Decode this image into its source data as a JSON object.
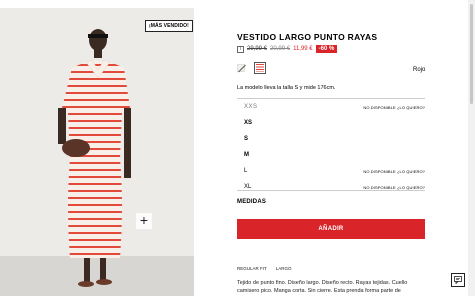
{
  "photo": {
    "badge": "¡MÁS VENDIDO!",
    "zoom_symbol": "+"
  },
  "product": {
    "title": "VESTIDO LARGO PUNTO RAYAS",
    "price_original": "29,99 €",
    "price_previous": "20,99 €",
    "price_sale": "11,99 €",
    "discount": "-60 %",
    "info_symbol": "i",
    "color_name": "Rojo",
    "model_info": "La modelo lleva la talla S y mide 176cm."
  },
  "sizes": [
    {
      "label": "XXS",
      "status": "NO DISPONIBLE ¿LO QUIERO?"
    },
    {
      "label": "XS",
      "status": ""
    },
    {
      "label": "S",
      "status": ""
    },
    {
      "label": "M",
      "status": ""
    },
    {
      "label": "L",
      "status": "NO DISPONIBLE ¿LO QUIERO?"
    },
    {
      "label": "XL",
      "status": "NO DISPONIBLE ¿LO QUIERO?"
    }
  ],
  "measures_label": "MEDIDAS",
  "add_button": "AÑADIR",
  "tags": [
    "REGULAR FIT",
    "LARGO"
  ],
  "description": "Tejido de punto fino. Diseño largo. Diseño recto. Rayas tejidas. Cuello camisero pico. Manga corta. Sin cierre. Esta prenda forma parte de",
  "colors": {
    "accent": "#d9242a",
    "stripe": "#e24a3c"
  }
}
